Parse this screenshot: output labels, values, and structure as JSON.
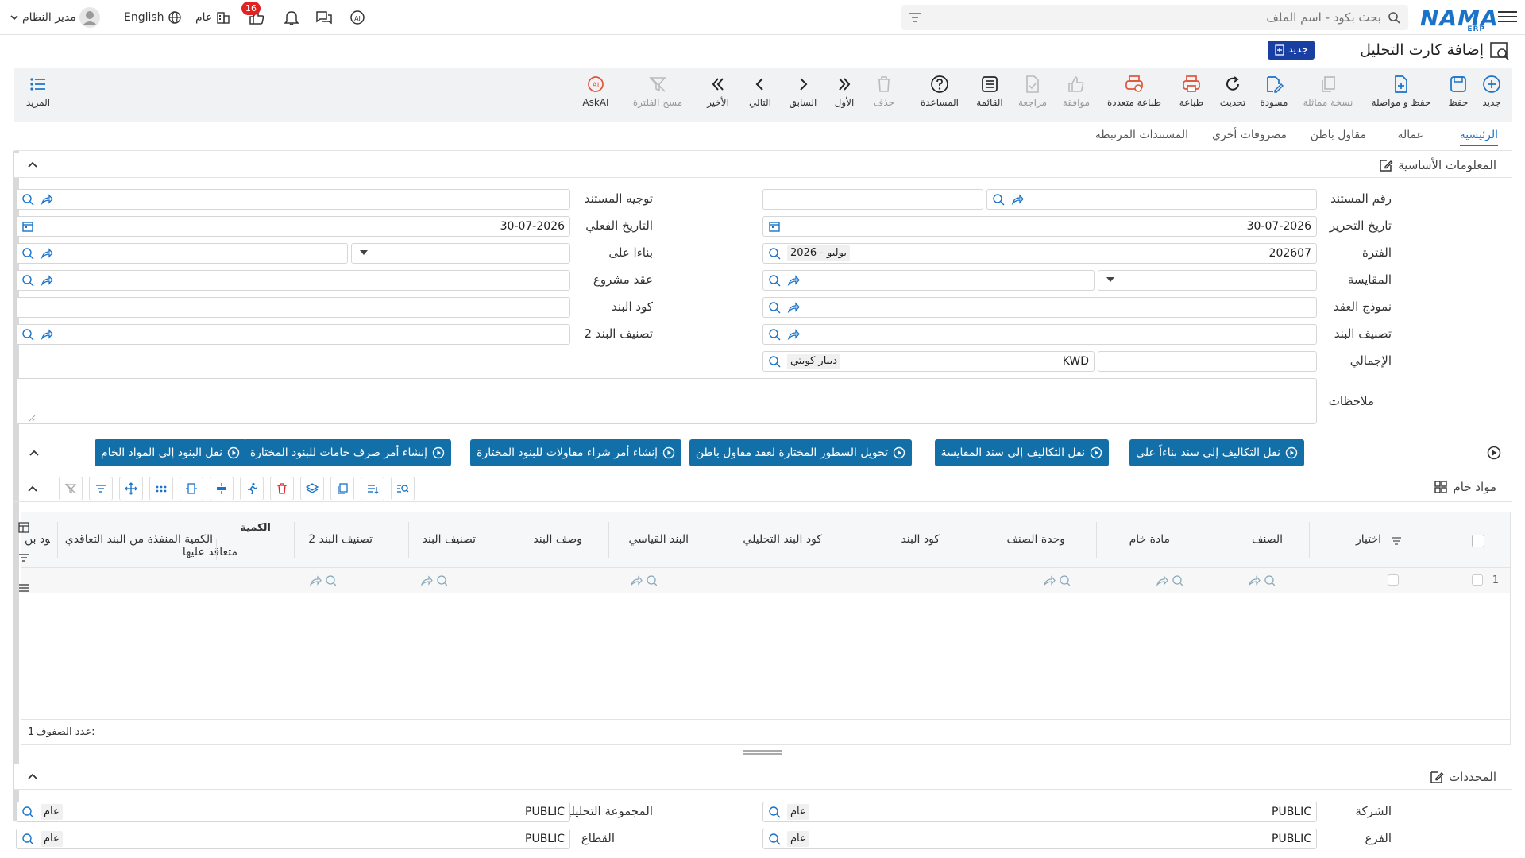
{
  "topbar": {
    "logo": "NAMA",
    "logo_sub": "ERP",
    "search_placeholder": "بحث بكود - اسم الملف",
    "user_name": "مدير النظام",
    "language": "English",
    "scope": "عام",
    "notifications_count": "16"
  },
  "title": {
    "text": "إضافة كارت التحليل",
    "new_badge": "جديد"
  },
  "toolbar": {
    "buttons": [
      {
        "label": "جديد"
      },
      {
        "label": "حفظ"
      },
      {
        "label": "حفظ و مواصلة"
      },
      {
        "label": "نسخة مماثلة"
      },
      {
        "label": "مسودة"
      },
      {
        "label": "تحديث"
      },
      {
        "label": "طباعة"
      },
      {
        "label": "طباعة متعددة"
      },
      {
        "label": "موافقة"
      },
      {
        "label": "مراجعة"
      },
      {
        "label": "القائمة"
      },
      {
        "label": "المساعدة"
      },
      {
        "label": "حذف"
      },
      {
        "label": "الأول"
      },
      {
        "label": "السابق"
      },
      {
        "label": "التالي"
      },
      {
        "label": "الأخير"
      },
      {
        "label": "مسح الفلترة"
      },
      {
        "label": "AskAI"
      }
    ],
    "more": "المزيد"
  },
  "tabs": [
    "الرئيسية",
    "عمالة",
    "مقاول باطن",
    "مصروفات أخري",
    "المستندات المرتبطة"
  ],
  "basic_info": {
    "title": "المعلومات الأساسية",
    "doc_number_label": "رقم المستند",
    "doc_direction_label": "توجيه المستند",
    "issue_date_label": "تاريخ التحرير",
    "issue_date": "30-07-2026",
    "actual_date_label": "التاريخ الفعلي",
    "actual_date": "30-07-2026",
    "period_label": "الفترة",
    "period_value": "202607",
    "period_chip": "2026 - يوليو",
    "based_on_label": "بناءا على",
    "measure_label": "المقايسة",
    "project_contract_label": "عقد مشروع",
    "contract_model_label": "نموذج العقد",
    "item_code_label": "كود البند",
    "item_class_label": "تصنيف البند",
    "item_class2_label": "تصنيف البند 2",
    "total_label": "الإجمالي",
    "currency_code": "KWD",
    "currency_chip": "دينار كويتي",
    "notes_label": "ملاحظات"
  },
  "actions": [
    "نقل التكاليف إلى سند بناءاً على",
    "نقل التكاليف إلى سند المقايسة",
    "تحويل السطور المختارة لعقد مقاول باطن",
    "إنشاء أمر شراء مقاولات للبنود المختارة",
    "إنشاء أمر صرف خامات للبنود المختارة",
    "نقل البنود إلى المواد الخام"
  ],
  "raw_materials": {
    "title": "مواد خام",
    "columns": [
      "اختيار",
      "الصنف",
      "مادة خام",
      "وحدة الصنف",
      "كود البند",
      "كود البند التحليلي",
      "البند القياسي",
      "وصف البند",
      "تصنيف البند",
      "تصنيف البند 2"
    ],
    "qty_group": "الكمية",
    "qty_sub": "متعاقد عليها",
    "executed_col": "الكمية المنفذة من البند التعاقدي",
    "last_col": "كود بن",
    "row_number": "1",
    "row_count_label": "عدد الصفوف:",
    "row_count": "1"
  },
  "determinants": {
    "title": "المحددات",
    "company_label": "الشركة",
    "company_value": "PUBLIC",
    "company_chip": "عام",
    "branch_label": "الفرع",
    "branch_value": "PUBLIC",
    "branch_chip": "عام",
    "analytic_group_label": "المجموعة التحليلية",
    "analytic_group_value": "PUBLIC",
    "analytic_group_chip": "عام",
    "sector_label": "القطاع",
    "sector_value": "PUBLIC",
    "sector_chip": "عام"
  },
  "colors": {
    "primary": "#1a73c8",
    "action": "#136fa8",
    "badge": "#e02424",
    "print": "#e0543a"
  }
}
